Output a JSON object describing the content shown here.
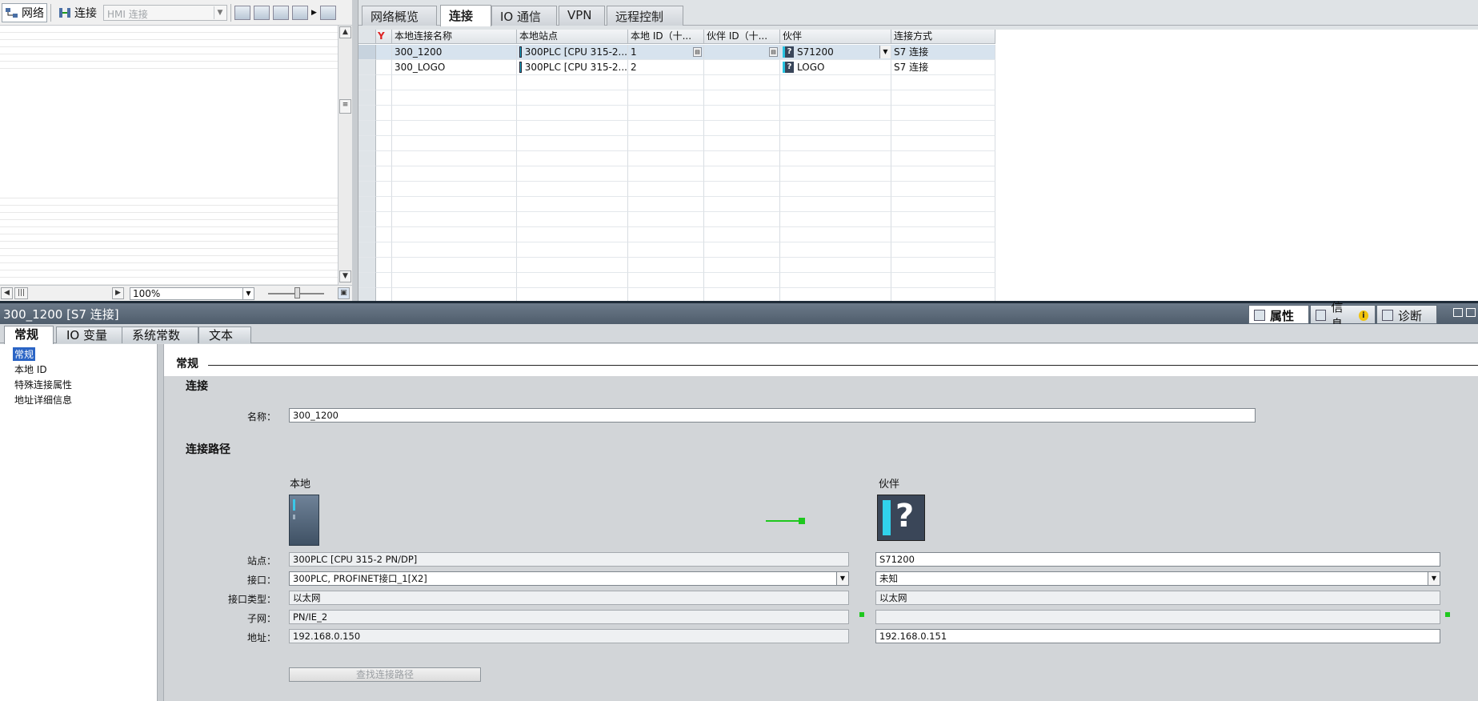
{
  "left_toolbar": {
    "network_label": "网络",
    "connection_label": "连接",
    "connection_type_value": "HMI 连接"
  },
  "left_bottom": {
    "zoom_value": "100%"
  },
  "top_tabs": [
    "网络概览",
    "连接",
    "IO 通信",
    "VPN",
    "远程控制"
  ],
  "table": {
    "columns": [
      "本地连接名称",
      "本地站点",
      "本地 ID（十...",
      "伙伴 ID（十...",
      "伙伴",
      "连接方式"
    ],
    "rows": [
      {
        "name": "300_1200",
        "station": "300PLC [CPU 315-2...",
        "local_id": "1",
        "partner_id": "",
        "partner": "S71200",
        "type": "S7 连接"
      },
      {
        "name": "300_LOGO",
        "station": "300PLC [CPU 315-2...",
        "local_id": "2",
        "partner_id": "",
        "partner": "LOGO",
        "type": "S7 连接"
      }
    ]
  },
  "inspector": {
    "title": "300_1200 [S7 连接]",
    "right_tabs": [
      "属性",
      "信息",
      "诊断"
    ],
    "info_badge": "i",
    "tabs": [
      "常规",
      "IO 变量",
      "系统常数",
      "文本"
    ],
    "nav": [
      "常规",
      "本地 ID",
      "特殊连接属性",
      "地址详细信息"
    ],
    "section_title": "常规",
    "connection_heading": "连接",
    "name_label": "名称：",
    "name_value": "300_1200",
    "path_heading": "连接路径",
    "local_heading": "本地",
    "partner_heading": "伙伴",
    "labels": {
      "station": "站点：",
      "interface": "接口：",
      "interface_type": "接口类型：",
      "subnet": "子网：",
      "address": "地址："
    },
    "local": {
      "station": "300PLC [CPU 315-2 PN/DP]",
      "interface": "300PLC, PROFINET接口_1[X2]",
      "interface_type": "以太网",
      "subnet": "PN/IE_2",
      "address": "192.168.0.150"
    },
    "partner": {
      "station": "S71200",
      "interface": "未知",
      "interface_type": "以太网",
      "subnet": "",
      "address": "192.168.0.151"
    },
    "find_path_button": "查找连接路径"
  }
}
